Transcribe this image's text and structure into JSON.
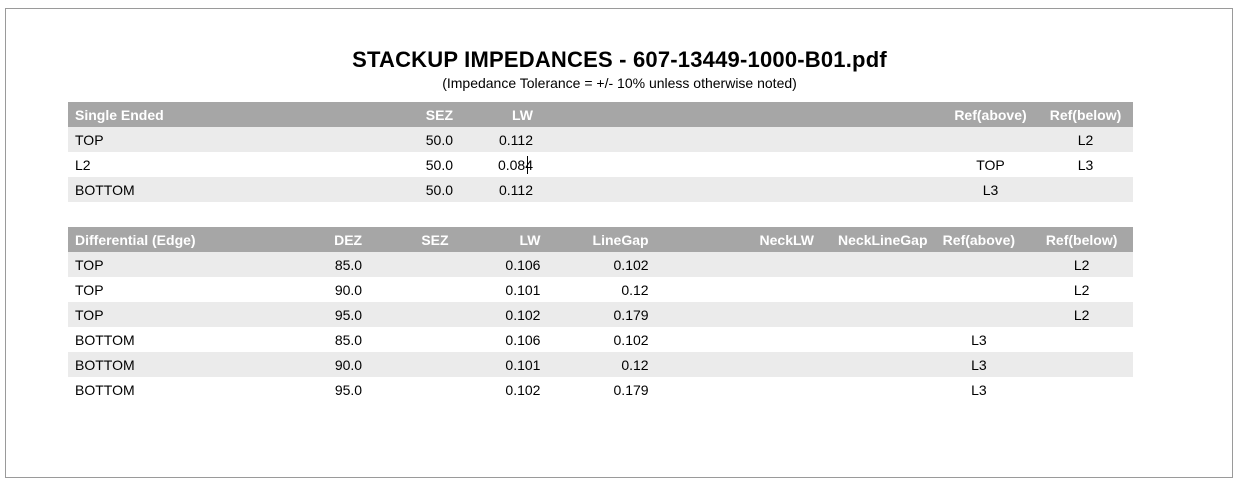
{
  "title": "STACKUP IMPEDANCES - 607-13449-1000-B01.pdf",
  "subtitle": "(Impedance Tolerance = +/- 10% unless otherwise noted)",
  "single_ended": {
    "headers": [
      "Single Ended",
      "SEZ",
      "LW",
      "Ref(above)",
      "Ref(below)"
    ],
    "rows": [
      {
        "layer": "TOP",
        "sez": "50.0",
        "lw": "0.112",
        "ref_above": "",
        "ref_below": "L2"
      },
      {
        "layer": "L2",
        "sez": "50.0",
        "lw": "0.084",
        "ref_above": "TOP",
        "ref_below": "L3"
      },
      {
        "layer": "BOTTOM",
        "sez": "50.0",
        "lw": "0.112",
        "ref_above": "L3",
        "ref_below": ""
      }
    ]
  },
  "differential": {
    "headers": [
      "Differential (Edge)",
      "DEZ",
      "SEZ",
      "LW",
      "LineGap",
      "NeckLW",
      "NeckLineGap",
      "Ref(above)",
      "Ref(below)"
    ],
    "rows": [
      {
        "layer": "TOP",
        "dez": "85.0",
        "sez": "",
        "lw": "0.106",
        "gap": "0.102",
        "neck_lw": "",
        "neck_gap": "",
        "ref_above": "",
        "ref_below": "L2"
      },
      {
        "layer": "TOP",
        "dez": "90.0",
        "sez": "",
        "lw": "0.101",
        "gap": "0.12",
        "neck_lw": "",
        "neck_gap": "",
        "ref_above": "",
        "ref_below": "L2"
      },
      {
        "layer": "TOP",
        "dez": "95.0",
        "sez": "",
        "lw": "0.102",
        "gap": "0.179",
        "neck_lw": "",
        "neck_gap": "",
        "ref_above": "",
        "ref_below": "L2"
      },
      {
        "layer": "BOTTOM",
        "dez": "85.0",
        "sez": "",
        "lw": "0.106",
        "gap": "0.102",
        "neck_lw": "",
        "neck_gap": "",
        "ref_above": "L3",
        "ref_below": ""
      },
      {
        "layer": "BOTTOM",
        "dez": "90.0",
        "sez": "",
        "lw": "0.101",
        "gap": "0.12",
        "neck_lw": "",
        "neck_gap": "",
        "ref_above": "L3",
        "ref_below": ""
      },
      {
        "layer": "BOTTOM",
        "dez": "95.0",
        "sez": "",
        "lw": "0.102",
        "gap": "0.179",
        "neck_lw": "",
        "neck_gap": "",
        "ref_above": "L3",
        "ref_below": ""
      }
    ]
  }
}
